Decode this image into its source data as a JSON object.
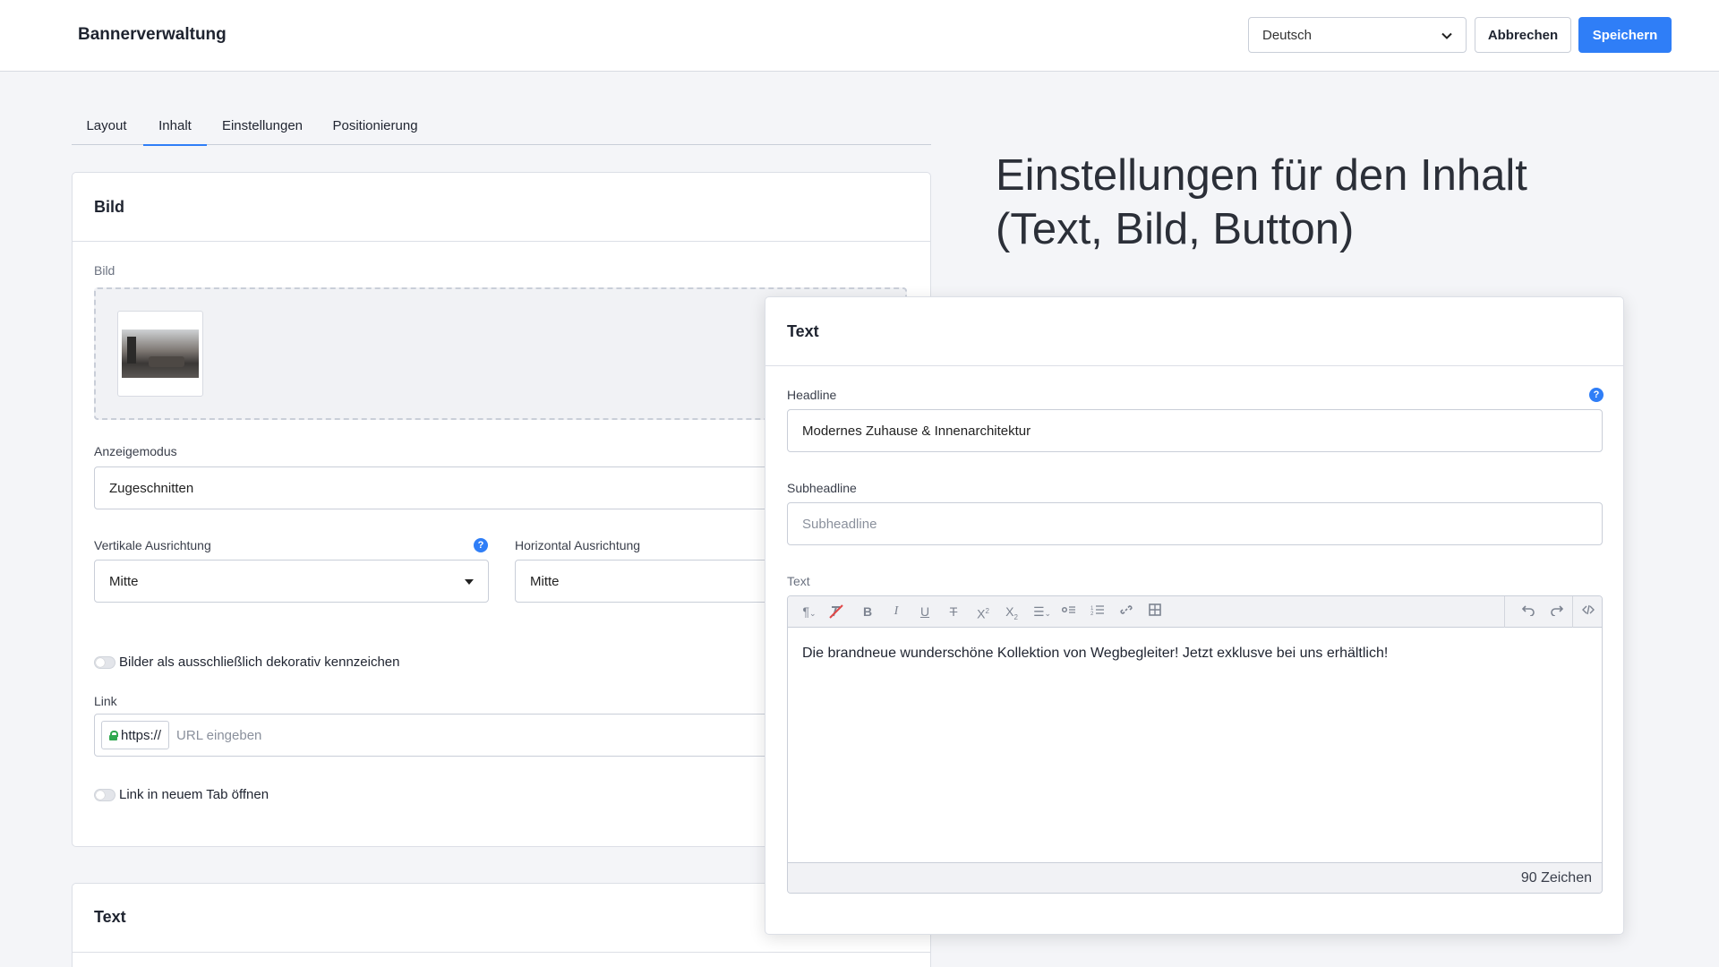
{
  "header": {
    "title": "Bannerverwaltung",
    "language": "Deutsch",
    "cancel_label": "Abbrechen",
    "save_label": "Speichern"
  },
  "tabs": [
    {
      "label": "Layout",
      "active": false
    },
    {
      "label": "Inhalt",
      "active": true
    },
    {
      "label": "Einstellungen",
      "active": false
    },
    {
      "label": "Positionierung",
      "active": false
    }
  ],
  "image_card": {
    "title": "Bild",
    "image_label": "Bild",
    "display_mode_label": "Anzeigemodus",
    "display_mode_value": "Zugeschnitten",
    "vertical_label": "Vertikale Ausrichtung",
    "vertical_value": "Mitte",
    "horizontal_label": "Horizontal Ausrichtung",
    "horizontal_value": "Mitte",
    "decorative_label": "Bilder als ausschließlich dekorativ kennzeichen",
    "link_label": "Link",
    "link_prefix": "https://",
    "link_placeholder": "URL eingeben",
    "new_tab_label": "Link in neuem Tab öffnen"
  },
  "text_card_bottom": {
    "title": "Text"
  },
  "annotation": {
    "heading": "Einstellungen für den Inhalt (Text, Bild, Button)"
  },
  "text_panel": {
    "title": "Text",
    "headline_label": "Headline",
    "headline_value": "Modernes Zuhause & Innenarchitektur",
    "subheadline_label": "Subheadline",
    "subheadline_placeholder": "Subheadline",
    "text_label": "Text",
    "text_value": "Die brandneue wunderschöne Kollektion von Wegbegleiter! Jetzt exklusve bei uns erhältlich!",
    "char_count": "90 Zeichen"
  },
  "colors": {
    "accent": "#2f7ef7",
    "lock": "#2fa84f"
  },
  "toolbar_icons": [
    "paragraph-icon",
    "clear-format-icon",
    "bold-icon",
    "italic-icon",
    "underline-icon",
    "strikethrough-icon",
    "superscript-icon",
    "subscript-icon",
    "align-icon",
    "bullet-list-icon",
    "numbered-list-icon",
    "link-icon",
    "table-icon",
    "undo-icon",
    "redo-icon",
    "code-icon"
  ]
}
